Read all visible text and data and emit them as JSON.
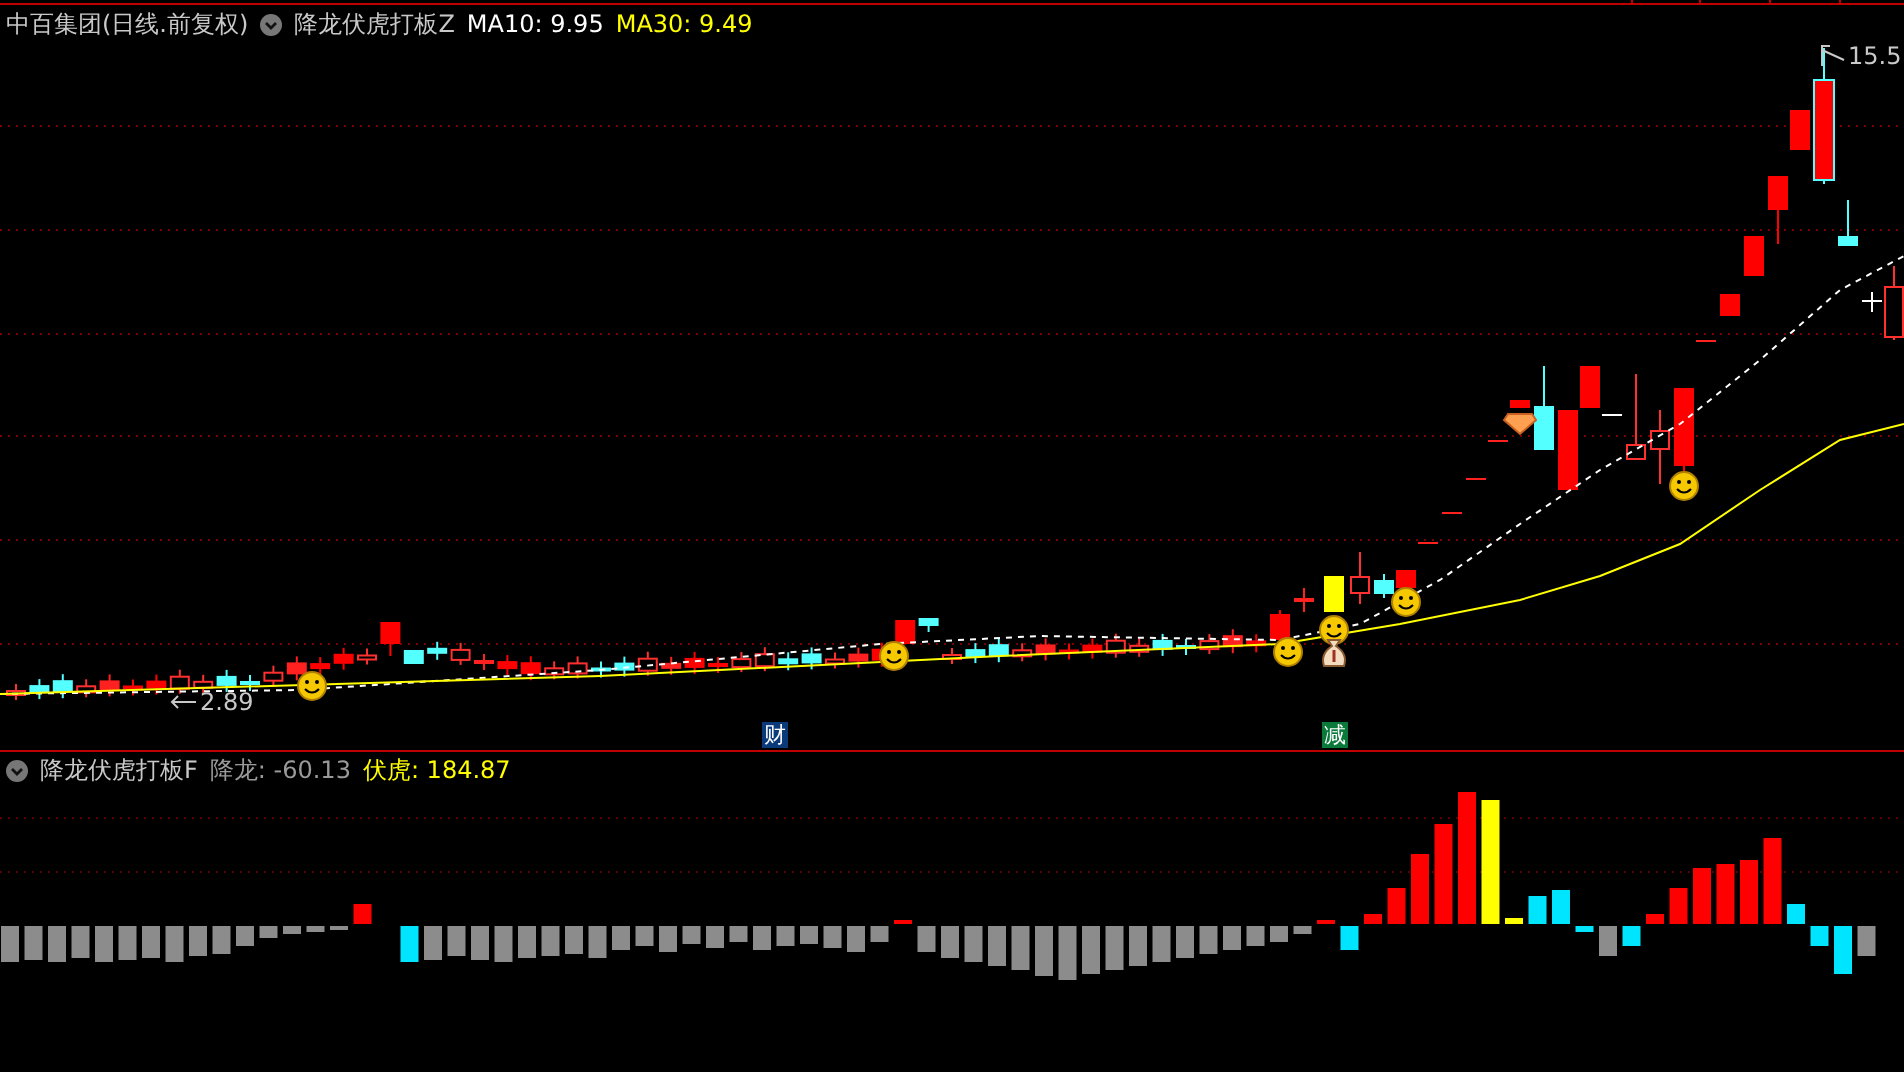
{
  "header": {
    "title": "中百集团(日线.前复权)",
    "indicator": "降龙伏虎打板Z",
    "moving_averages": [
      {
        "text": "MA10: 9.95",
        "color": "#ffffff"
      },
      {
        "text": "MA30: 9.49",
        "color": "#ffff00"
      }
    ]
  },
  "main_chart": {
    "high_label": "15.5",
    "low_label": "2.89",
    "markers": [
      {
        "text": "财",
        "kind": "finance"
      },
      {
        "text": "减",
        "kind": "reduce"
      }
    ]
  },
  "sub_header": {
    "indicator": "降龙伏虎打板F",
    "series": [
      {
        "text": "降龙: -60.13",
        "color": "#9a9a9a"
      },
      {
        "text": "伏虎: 184.87",
        "color": "#ffff00"
      }
    ]
  }
}
